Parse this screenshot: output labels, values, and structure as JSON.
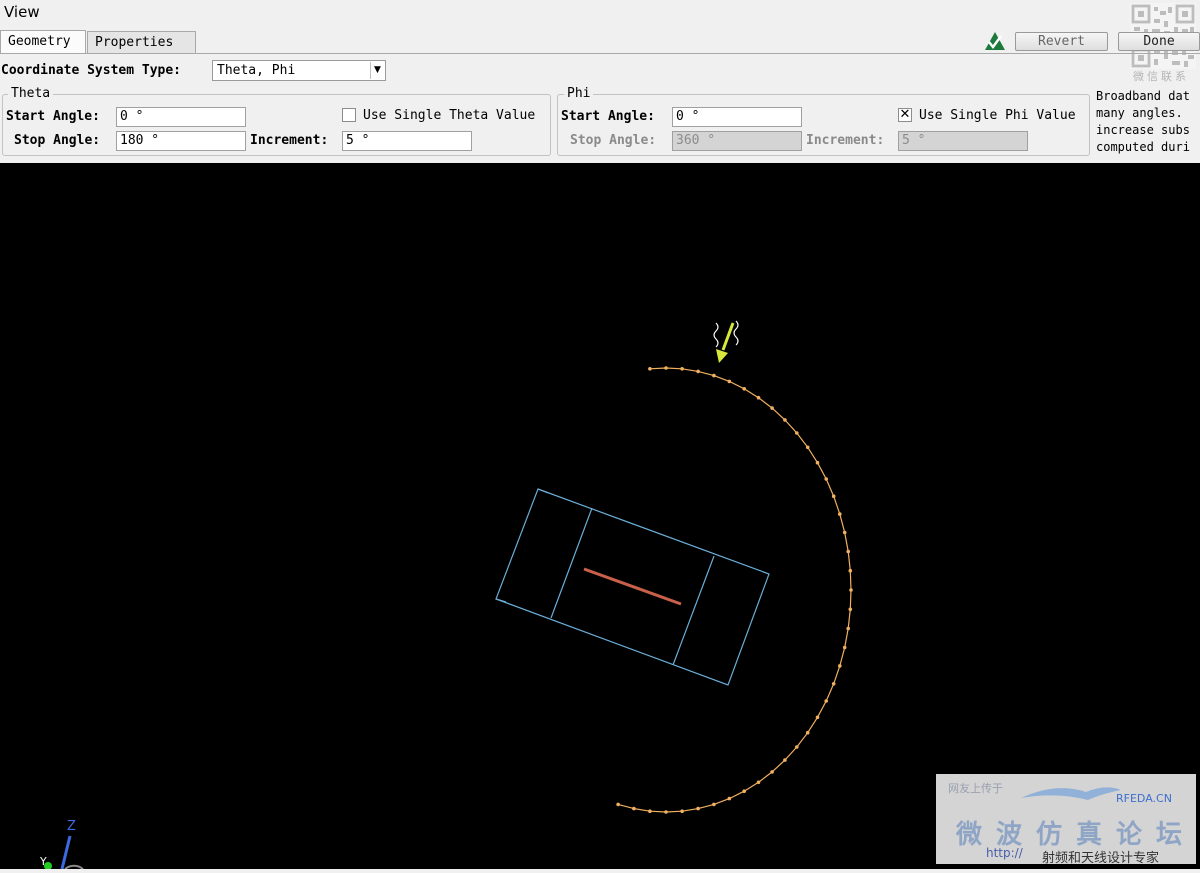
{
  "window": {
    "title": "View"
  },
  "tabs": [
    {
      "label": "Geometry",
      "active": true
    },
    {
      "label": "Properties",
      "active": false
    }
  ],
  "toolbar": {
    "revert_label": "Revert",
    "done_label": "Done",
    "logo_icon": "green-check-logo-icon"
  },
  "coord": {
    "label": "Coordinate System Type:",
    "value": "Theta, Phi"
  },
  "theta": {
    "title": "Theta",
    "start_label": "Start Angle:",
    "start_value": "0 °",
    "stop_label": "Stop Angle:",
    "stop_value": "180 °",
    "increment_label": "Increment:",
    "increment_value": "5 °",
    "single_label": "Use Single Theta Value",
    "single_checked": false
  },
  "phi": {
    "title": "Phi",
    "start_label": "Start Angle:",
    "start_value": "0 °",
    "stop_label": "Stop Angle:",
    "stop_value": "360 °",
    "increment_label": "Increment:",
    "increment_value": "5 °",
    "single_label": "Use Single Phi Value",
    "single_checked": true,
    "check_mark": "✕"
  },
  "info": {
    "lines": [
      "Broadband dat",
      "many angles.",
      "increase subs",
      "computed duri"
    ]
  },
  "axes": {
    "z": "Z",
    "y": "Y"
  },
  "watermark": {
    "qr_caption": "微信联系",
    "top_text": "网友上传于",
    "brand": "RFEDA.CN",
    "big_text": "微波仿真论坛",
    "url": "http://",
    "slogan": "射频和天线设计专家"
  },
  "colors": {
    "viewport": "#000000",
    "box": "#6aaed8",
    "dipole": "#c9604a",
    "arc": "#f0b060",
    "source": "#d8e83a"
  }
}
